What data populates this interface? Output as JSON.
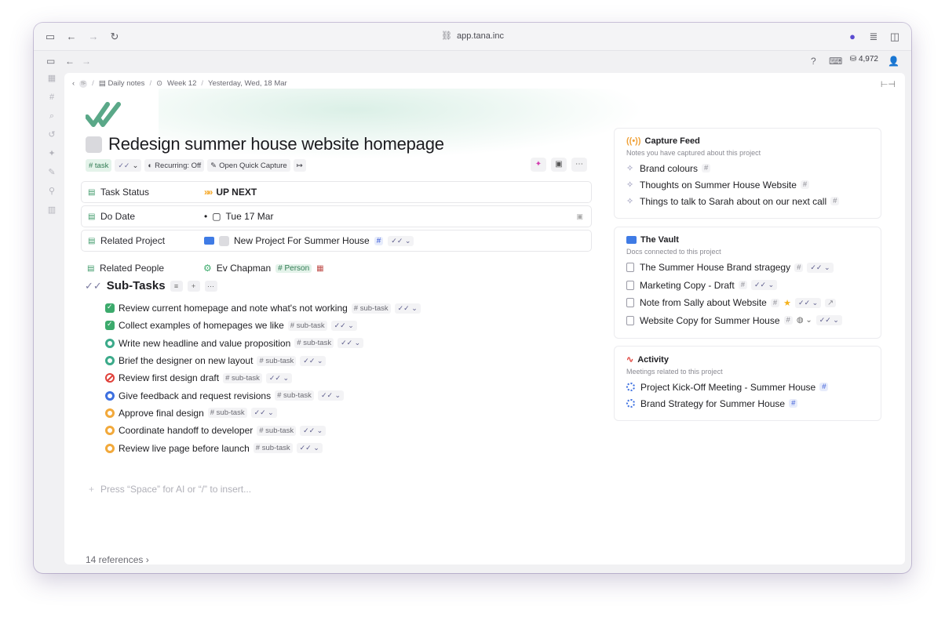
{
  "browser": {
    "url": "app.tana.inc"
  },
  "app": {
    "coins": "4,972"
  },
  "breadcrumb": {
    "avatar": "TF",
    "daily_notes": "Daily notes",
    "week": "Week 12",
    "day": "Yesterday, Wed, 18 Mar"
  },
  "node": {
    "title": "Redesign summer house website homepage",
    "tag": "# task",
    "recurring": "Recurring: Off",
    "quick_capture": "Open Quick Capture"
  },
  "fields": {
    "task_status": {
      "label": "Task Status",
      "value": "UP NEXT"
    },
    "due_date": {
      "label": "Do Date",
      "value": "Tue 17 Mar"
    },
    "related_project": {
      "label": "Related Project",
      "value": "New Project For Summer House",
      "tag": "#"
    },
    "related_people": {
      "label": "Related People",
      "value": "Ev Chapman",
      "tag": "# Person"
    }
  },
  "subtasks": {
    "heading": "Sub-Tasks",
    "tag": "# sub-task",
    "items": [
      {
        "label": "Review current homepage and note what's not working",
        "status": "done"
      },
      {
        "label": "Collect examples of homepages we like",
        "status": "done"
      },
      {
        "label": "Write new headline and value proposition",
        "status": "prog"
      },
      {
        "label": "Brief the designer on new layout",
        "status": "prog"
      },
      {
        "label": "Review first design draft",
        "status": "block"
      },
      {
        "label": "Give feedback and request revisions",
        "status": "review"
      },
      {
        "label": "Approve final design",
        "status": "todo"
      },
      {
        "label": "Coordinate handoff to developer",
        "status": "todo"
      },
      {
        "label": "Review live page before launch",
        "status": "todo"
      }
    ]
  },
  "editor": {
    "placeholder": "Press “Space” for AI or “/” to insert..."
  },
  "references": "14 references",
  "capture_feed": {
    "title": "Capture Feed",
    "subtitle": "Notes you have captured about this project",
    "items": [
      "Brand colours",
      "Thoughts on Summer House Website",
      "Things to talk to Sarah about on our next call"
    ]
  },
  "vault": {
    "title": "The Vault",
    "subtitle": "Docs connected to this project",
    "items": [
      "The Summer House Brand stragegy",
      "Marketing Copy - Draft",
      "Note from Sally about Website",
      "Website Copy for Summer House"
    ]
  },
  "activity": {
    "title": "Activity",
    "subtitle": "Meetings related to this project",
    "items": [
      "Project Kick-Off Meeting - Summer House",
      "Brand Strategy for Summer House"
    ]
  },
  "colors": {
    "accent": "#3caa6c",
    "tag_blue": "#3b5bd8",
    "upnext": "#f5a623"
  }
}
